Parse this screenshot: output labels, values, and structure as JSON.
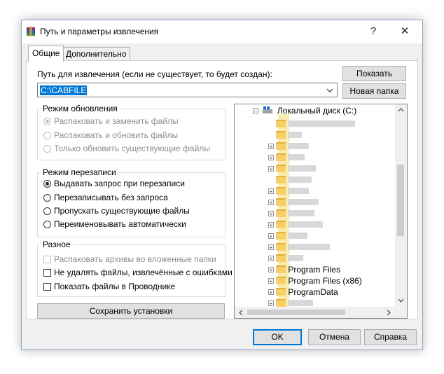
{
  "window": {
    "title": "Путь и параметры извлечения",
    "help_glyph": "?",
    "close_glyph": "✕"
  },
  "tabs": [
    {
      "label": "Общие",
      "active": true
    },
    {
      "label": "Дополнительно",
      "active": false
    }
  ],
  "path": {
    "label": "Путь для извлечения (если не существует, то будет создан):",
    "value": "C:\\CABFILE",
    "show_button": "Показать",
    "new_folder_button": "Новая папка"
  },
  "update_mode": {
    "title": "Режим обновления",
    "options": [
      {
        "label": "Распаковать и заменить файлы",
        "selected": true,
        "disabled": true
      },
      {
        "label": "Распаковать и обновить файлы",
        "selected": false,
        "disabled": true
      },
      {
        "label": "Только обновить существующие файлы",
        "selected": false,
        "disabled": true
      }
    ]
  },
  "overwrite_mode": {
    "title": "Режим перезаписи",
    "options": [
      {
        "label": "Выдавать запрос при перезаписи",
        "selected": true
      },
      {
        "label": "Перезаписывать без запроса",
        "selected": false
      },
      {
        "label": "Пропускать существующие файлы",
        "selected": false
      },
      {
        "label": "Переименовывать автоматически",
        "selected": false
      }
    ]
  },
  "misc": {
    "title": "Разное",
    "options": [
      {
        "label": "Распаковать архивы во вложенные папки",
        "checked": false,
        "disabled": true
      },
      {
        "label": "Не удалять файлы, извлечённые с ошибками",
        "checked": false,
        "disabled": false
      },
      {
        "label": "Показать файлы в Проводнике",
        "checked": false,
        "disabled": false
      }
    ]
  },
  "save_settings_button": "Сохранить установки",
  "tree": {
    "root": "Локальный диск (C:)",
    "folders": [
      "Program Files",
      "Program Files (x86)",
      "ProgramData"
    ]
  },
  "buttons": {
    "ok": "OK",
    "cancel": "Отмена",
    "help": "Справка"
  },
  "colors": {
    "accent": "#0078d7",
    "folder": "#f5cf67"
  }
}
